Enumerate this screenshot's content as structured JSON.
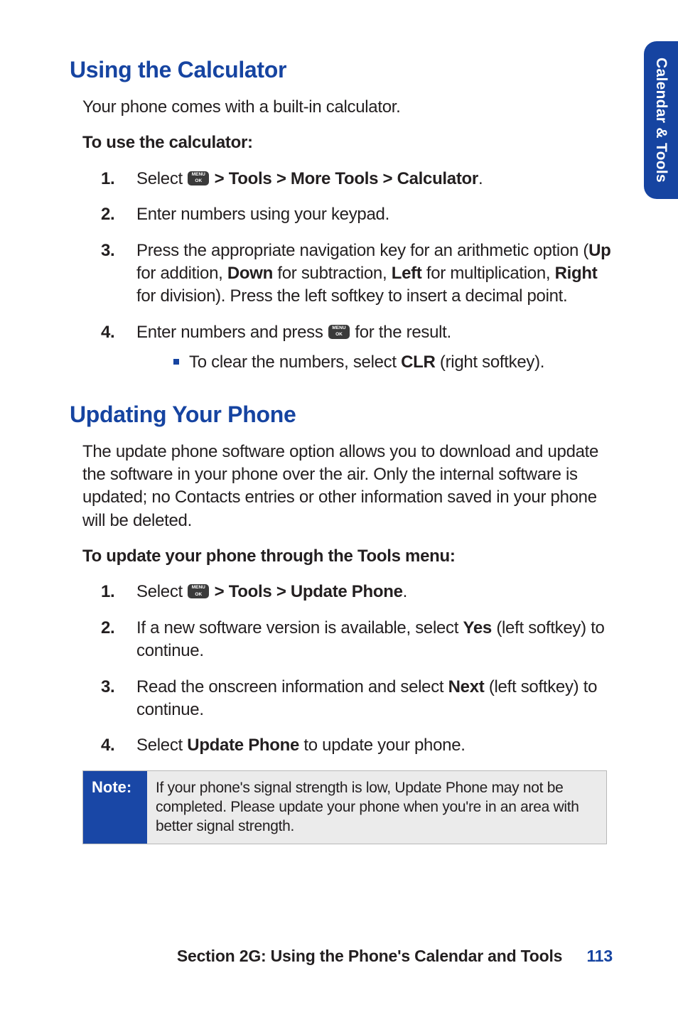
{
  "side_tab": "Calendar & Tools",
  "section1": {
    "heading": "Using the Calculator",
    "intro": "Your phone comes with a built-in calculator.",
    "subhead": "To use the calculator:",
    "steps": [
      {
        "num": "1.",
        "pre": "Select ",
        "post_bold": " > Tools > More Tools > Calculator",
        "tail": "."
      },
      {
        "num": "2.",
        "text": "Enter numbers using your keypad."
      },
      {
        "num": "3.",
        "parts": {
          "a": "Press the appropriate navigation key for an arithmetic option (",
          "up": "Up",
          "b": " for addition, ",
          "down": "Down",
          "c": " for subtraction, ",
          "left": "Left",
          "d": " for multiplication, ",
          "right": "Right",
          "e": " for division). Press the left softkey to insert a decimal point."
        }
      },
      {
        "num": "4.",
        "pre": "Enter numbers and press ",
        "tail": " for the result.",
        "bullet_pre": "To clear the numbers, select ",
        "bullet_bold": "CLR",
        "bullet_post": " (right softkey)."
      }
    ]
  },
  "section2": {
    "heading": "Updating Your Phone",
    "intro": "The update phone software option allows you to download and update the software in your phone over the air. Only the internal software is updated; no Contacts entries or other information saved in your phone will be deleted.",
    "subhead": "To update your phone through the Tools menu:",
    "steps": [
      {
        "num": "1.",
        "pre": "Select ",
        "post_bold": " > Tools > Update Phone",
        "tail": "."
      },
      {
        "num": "2.",
        "a": "If a new software version is available, select ",
        "bold": "Yes",
        "b": " (left softkey) to continue."
      },
      {
        "num": "3.",
        "a": "Read the onscreen information and select ",
        "bold": "Next",
        "b": " (left softkey) to continue."
      },
      {
        "num": "4.",
        "a": "Select ",
        "bold": "Update Phone",
        "b": " to update your phone."
      }
    ]
  },
  "note": {
    "label": "Note:",
    "text": "If your phone's signal strength is low, Update Phone may not be completed. Please update your phone when you're in an area with better signal strength."
  },
  "footer": {
    "section": "Section 2G: Using the Phone's Calendar and Tools",
    "page": "113"
  }
}
